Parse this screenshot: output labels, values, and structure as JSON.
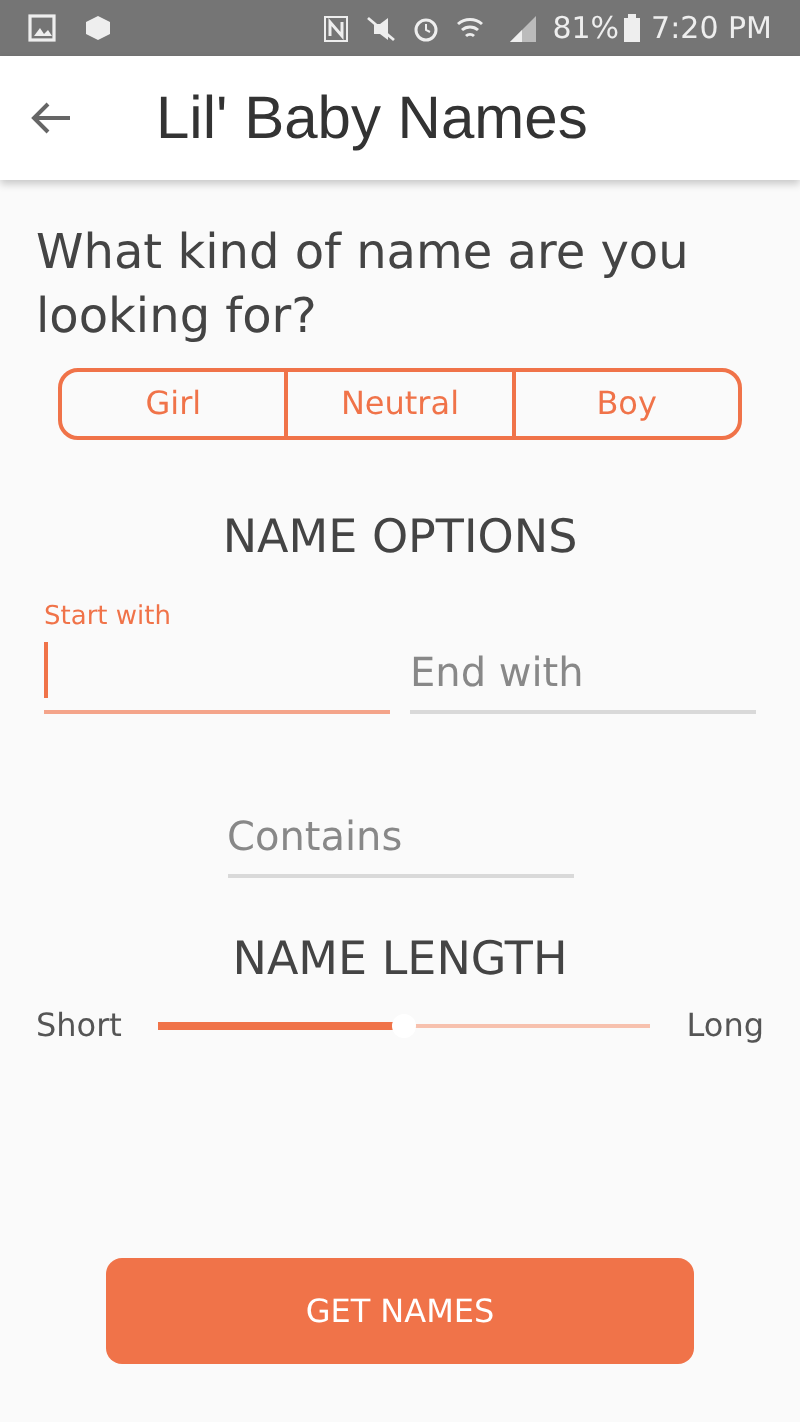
{
  "status_bar": {
    "battery": "81%",
    "time": "7:20 PM"
  },
  "app_bar": {
    "title": "Lil' Baby Names"
  },
  "question": "What kind of name are you looking for?",
  "gender_options": [
    {
      "label": "Girl",
      "selected": false
    },
    {
      "label": "Neutral",
      "selected": false
    },
    {
      "label": "Boy",
      "selected": false
    }
  ],
  "name_options": {
    "title": "NAME OPTIONS",
    "fields": [
      {
        "label": "Start with",
        "focused": true
      },
      {
        "placeholder": "End with",
        "focused": false
      },
      {
        "placeholder": "Contains",
        "focused": false
      }
    ]
  },
  "name_length": {
    "title": "NAME LENGTH",
    "min_label": "Short",
    "max_label": "Long",
    "level": 0.5
  },
  "submit_button": "GET NAMES"
}
